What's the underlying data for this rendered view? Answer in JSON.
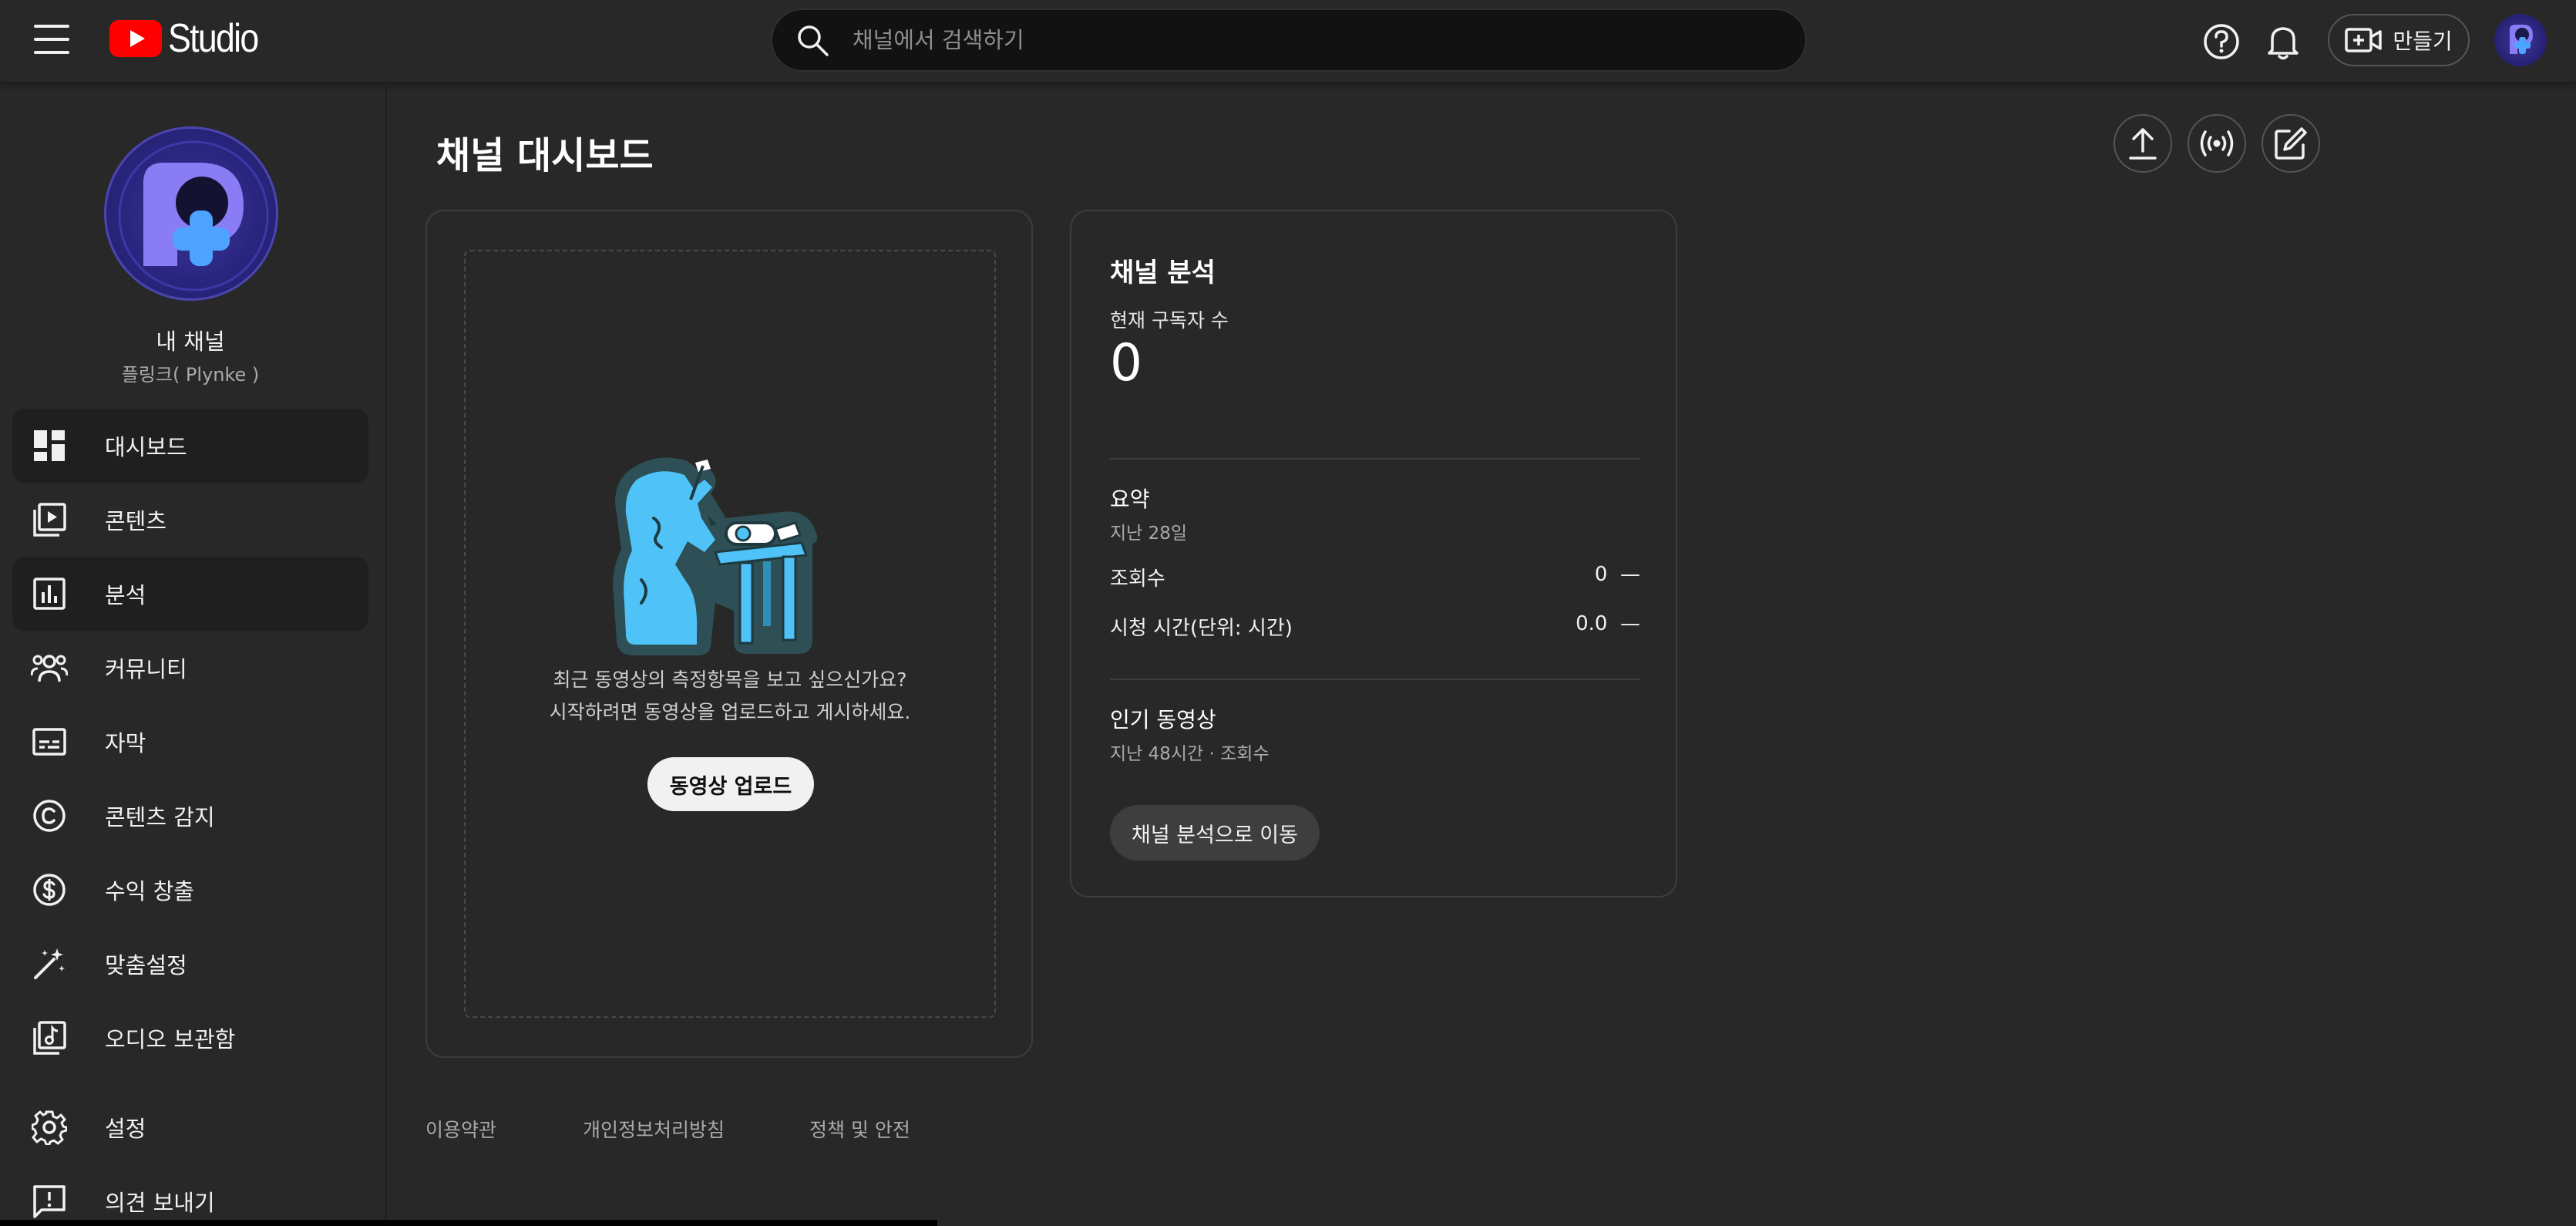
{
  "app": {
    "logo_text": "Studio"
  },
  "search": {
    "placeholder": "채널에서 검색하기"
  },
  "header": {
    "create_label": "만들기"
  },
  "channel": {
    "title": "내 채널",
    "subtitle": "플링크( Plynke )"
  },
  "sidebar": {
    "items": [
      {
        "label": "대시보드",
        "icon": "dashboard-icon",
        "active": true
      },
      {
        "label": "콘텐츠",
        "icon": "content-icon"
      },
      {
        "label": "분석",
        "icon": "analytics-icon",
        "active": true
      },
      {
        "label": "커뮤니티",
        "icon": "community-icon"
      },
      {
        "label": "자막",
        "icon": "subtitles-icon"
      },
      {
        "label": "콘텐츠 감지",
        "icon": "copyright-icon"
      },
      {
        "label": "수익 창출",
        "icon": "dollar-icon"
      },
      {
        "label": "맞춤설정",
        "icon": "magic-wand-icon"
      },
      {
        "label": "오디오 보관함",
        "icon": "audio-library-icon"
      },
      {
        "label": "설정",
        "icon": "gear-icon"
      },
      {
        "label": "의견 보내기",
        "icon": "feedback-icon"
      }
    ]
  },
  "main": {
    "title": "채널 대시보드"
  },
  "upload_card": {
    "line1": "최근 동영상의 측정항목을 보고 싶으신가요?",
    "line2": "시작하려면 동영상을 업로드하고 게시하세요.",
    "button": "동영상 업로드"
  },
  "analytics_card": {
    "title": "채널 분석",
    "subscribers_label": "현재 구독자 수",
    "subscribers_value": "0",
    "summary_title": "요약",
    "summary_period": "지난 28일",
    "metrics": [
      {
        "label": "조회수",
        "value": "0",
        "trend": "—"
      },
      {
        "label": "시청 시간(단위: 시간)",
        "value": "0.0",
        "trend": "—"
      }
    ],
    "popular_title": "인기 동영상",
    "popular_period": "지난 48시간 · 조회수",
    "button": "채널 분석으로 이동"
  },
  "footer": {
    "links": [
      "이용약관",
      "개인정보처리방침",
      "정책 및 안전"
    ]
  },
  "colors": {
    "background": "#282828",
    "logo_red": "#ff0000",
    "avatar_purple": "#2a2680",
    "avatar_accent": "#7c6ff0",
    "plus_blue": "#4da3ff",
    "illustration_blue": "#4fc3f7"
  }
}
